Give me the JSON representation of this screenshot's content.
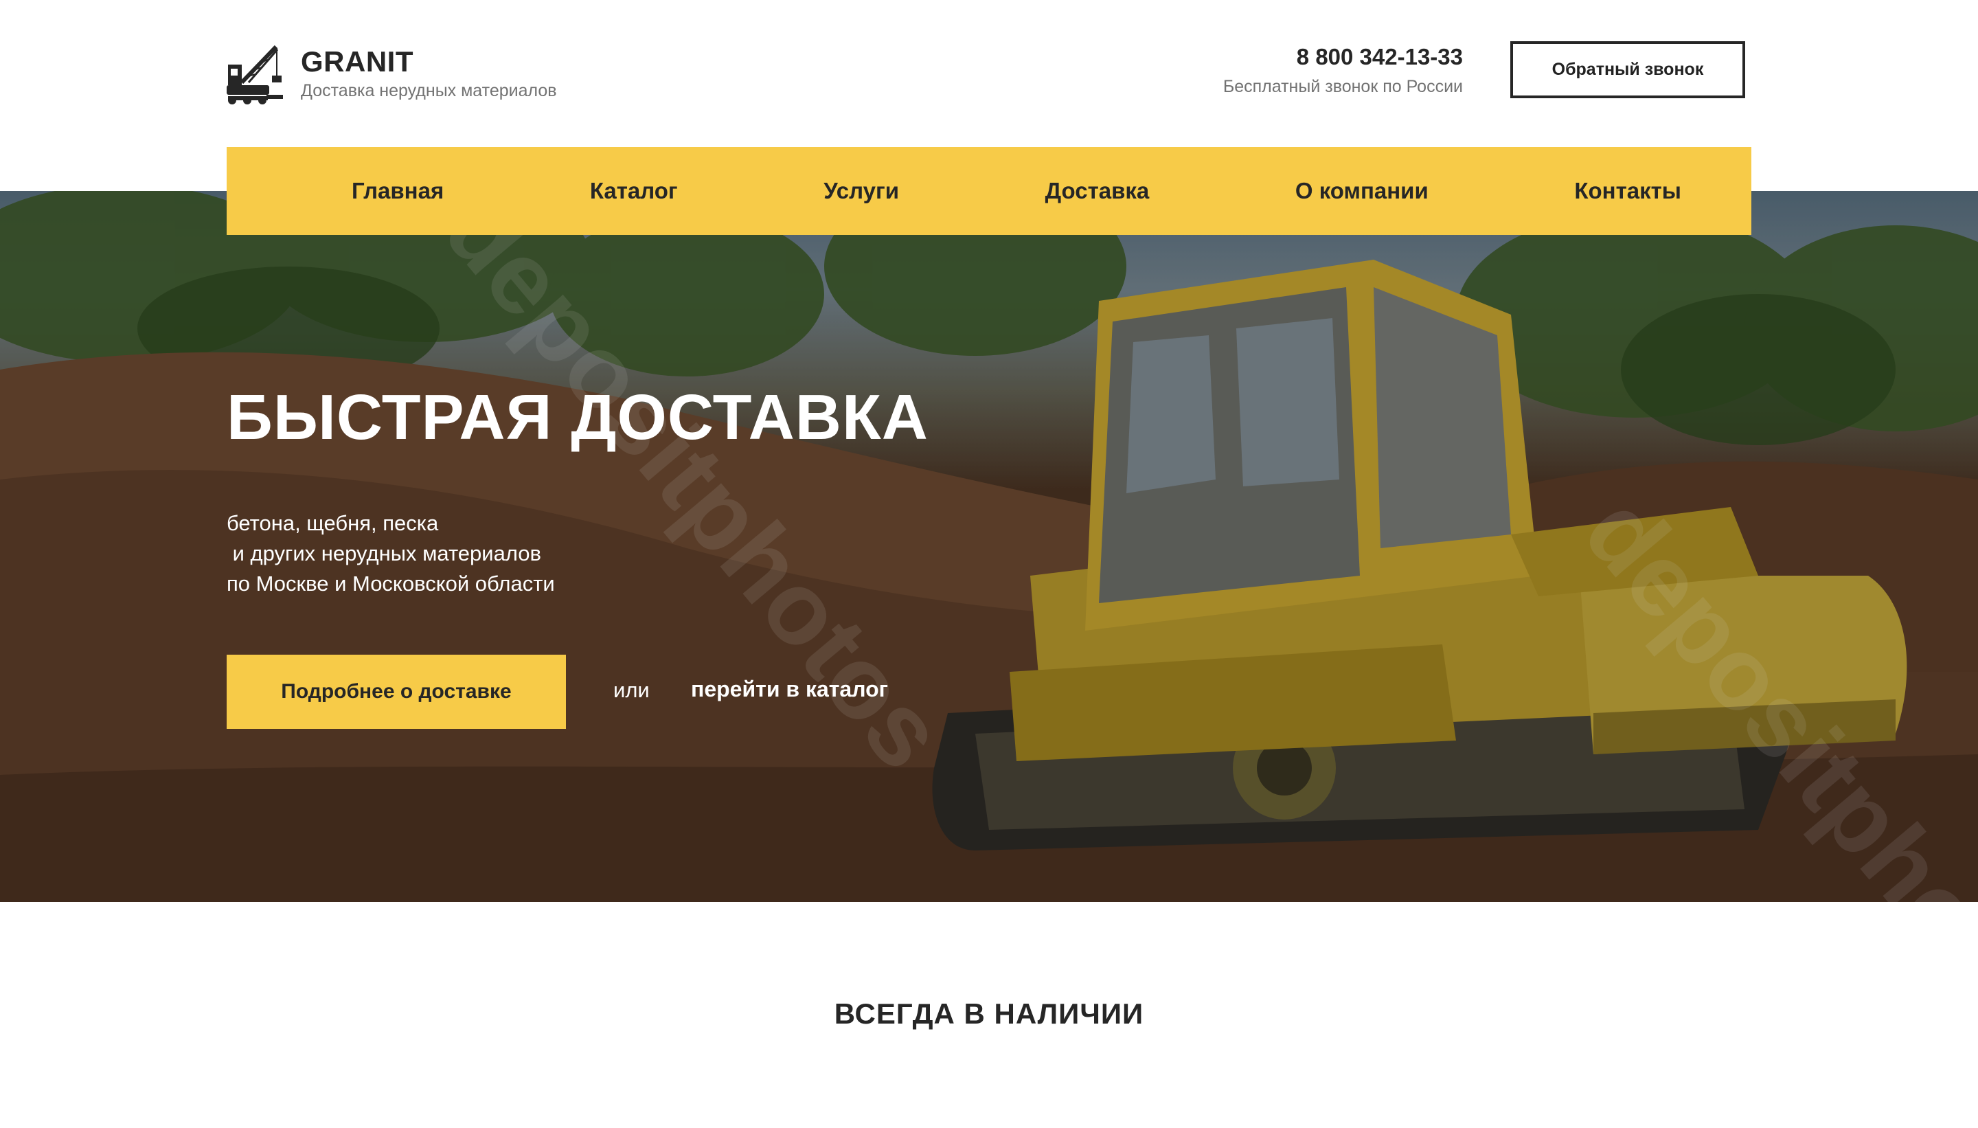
{
  "header": {
    "brand_name": "GRANIT",
    "brand_tagline": "Доставка нерудных материалов",
    "logo_icon": "crane-icon",
    "phone": "8 800 342-13-33",
    "phone_note": "Бесплатный звонок по России",
    "callback_label": "Обратный звонок"
  },
  "nav": {
    "items": [
      {
        "label": "Главная"
      },
      {
        "label": "Каталог"
      },
      {
        "label": "Услуги"
      },
      {
        "label": "Доставка"
      },
      {
        "label": "О компании"
      },
      {
        "label": "Контакты"
      }
    ]
  },
  "hero": {
    "title": "БЫСТРАЯ ДОСТАВКА",
    "description_lines": [
      "бетона, щебня, песка",
      " и других нерудных материалов",
      "по Москве и Московской области"
    ],
    "cta_label": "Подробнее о доставке",
    "or_text": "или",
    "catalog_link": "перейти в каталог",
    "watermark": "depositphotos"
  },
  "section": {
    "title": "ВСЕГДА В НАЛИЧИИ"
  },
  "colors": {
    "accent": "#f7cb48",
    "text_dark": "#262626",
    "text_muted": "#727272",
    "white": "#ffffff"
  }
}
